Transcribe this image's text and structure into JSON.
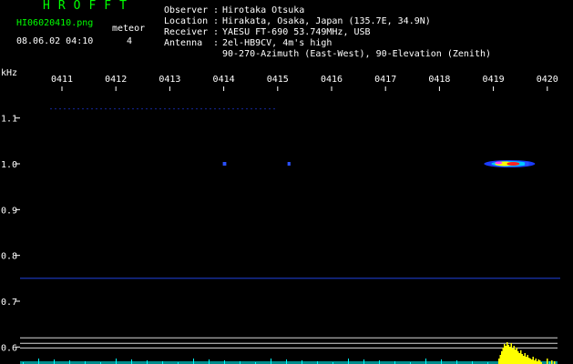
{
  "header": {
    "app_title": "HROFFT",
    "filename": "HI06020410.png",
    "datetime": "08.06.02 04:10",
    "meteor_label": "meteor",
    "meteor_count": "4",
    "info": [
      {
        "key": "Observer",
        "value": "Hirotaka Otsuka"
      },
      {
        "key": "Location",
        "value": "Hirakata, Osaka, Japan (135.7E, 34.9N)"
      },
      {
        "key": "Receiver",
        "value": "YAESU FT-690 53.749MHz, USB"
      },
      {
        "key": "Antenna",
        "value": "2el-HB9CV, 4m's high"
      }
    ],
    "antenna_line2": "90-270-Azimuth (East-West), 90-Elevation (Zenith)"
  },
  "colors": {
    "header_green": "#00ff00",
    "background": "#000000",
    "axis": "#ffffff",
    "noise_line": "#1e3cc8",
    "signal_peak": "#ff2020",
    "activity_yellow": "#ffff00",
    "activity_cyan": "#00ffff"
  },
  "chart_data": {
    "type": "heatmap",
    "ylabel": "kHz",
    "x_ticks": [
      "0411",
      "0412",
      "0413",
      "0414",
      "0415",
      "0416",
      "0417",
      "0418",
      "0419",
      "0420"
    ],
    "y_ticks": [
      "1.1",
      "1.0",
      "0.9",
      "0.8",
      "0.7",
      "0.6"
    ],
    "y_tick_values": [
      1.1,
      1.0,
      0.9,
      0.8,
      0.7,
      0.6
    ],
    "ylim": [
      0.595,
      1.16
    ],
    "xlim": [
      4.1,
      4.205
    ],
    "noise_line_khz": 0.75,
    "faint_line_khz": 1.12,
    "meteor_echoes": [
      {
        "time_min": 4.14,
        "freq_khz": 1.0,
        "strength": 0.3
      },
      {
        "time_min": 4.152,
        "freq_khz": 1.0,
        "strength": 0.2
      },
      {
        "time_min": 4.193,
        "freq_khz": 1.0,
        "strength": 1.0
      },
      {
        "time_min": 4.196,
        "freq_khz": 1.0,
        "strength": 0.4
      }
    ],
    "reference_lines_khz": [
      0.62,
      0.608,
      0.598
    ]
  }
}
